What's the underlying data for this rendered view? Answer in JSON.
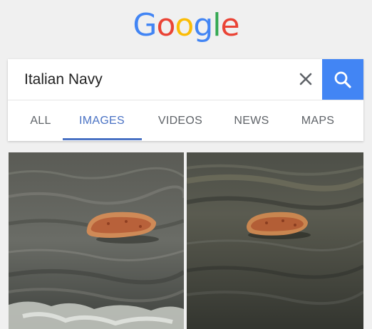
{
  "logo": {
    "letters": [
      "G",
      "o",
      "o",
      "g",
      "l",
      "e"
    ],
    "colors": [
      "#4285f4",
      "#ea4335",
      "#fbbc05",
      "#4285f4",
      "#34a853",
      "#ea4335"
    ]
  },
  "search": {
    "value": "Italian Navy",
    "clear_icon": "close-icon",
    "submit_icon": "search-icon",
    "accent": "#4285f4"
  },
  "tabs": [
    {
      "label": "ALL",
      "active": false
    },
    {
      "label": "IMAGES",
      "active": true
    },
    {
      "label": "VIDEOS",
      "active": false
    },
    {
      "label": "NEWS",
      "active": false
    },
    {
      "label": "MAPS",
      "active": false
    }
  ],
  "active_tab_color": "#4a72c4",
  "results": [
    {
      "kind": "image",
      "subject": "pizza-floating-on-water"
    },
    {
      "kind": "image",
      "subject": "pizza-floating-on-water"
    }
  ]
}
